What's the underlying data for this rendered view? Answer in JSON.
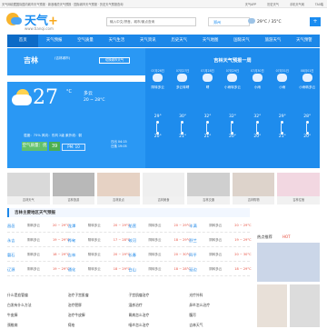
{
  "topbar": {
    "left_text": "天气网收藏国际国内城市天气预报 · 新浪雅虎天气预报 · 国际城市天气预报 · 历史天气预报查询",
    "right_items": [
      "天气APP",
      "历史天气",
      "手机天气网",
      "TA0端"
    ]
  },
  "logo": {
    "text": "天气",
    "plus": "+",
    "url": "www.tianqi.com"
  },
  "search": {
    "placeholder": "输入中文/拼音，城市/景点查询"
  },
  "location": {
    "value": "郑州"
  },
  "current_temp": {
    "text": "29°C / 35°C"
  },
  "nav": {
    "items": [
      "首页",
      "天气预报",
      "空气质量",
      "天气生活",
      "天气资讯",
      "历史天气",
      "天气地图",
      "国际天气",
      "旅游天气",
      "天气预警"
    ]
  },
  "main": {
    "city": "吉林",
    "city_link": "(吉林城市)",
    "switch_label": "切换城市天气",
    "date_line": "2019年07月26日  星期五  农历六月廿四",
    "temp": "27",
    "temp_unit": "°C",
    "cond": "多云",
    "range": "20 ~ 28°C",
    "winds": "湿度：75%   风向：东风 2级   紫外线：弱",
    "aqi_label": "空气质量：优",
    "aqi_value": "39",
    "pm": "PM: 10",
    "sun_rise": "日出 04:15",
    "sun_set": "日落 19:05"
  },
  "forecast": {
    "title": "吉林天气预报一周",
    "days": [
      {
        "date": "07月26日",
        "cond": "阴转多云",
        "high": "29°",
        "low": "20°"
      },
      {
        "date": "07月27日",
        "cond": "多云转晴",
        "high": "30°",
        "low": "21°"
      },
      {
        "date": "07月28日",
        "cond": "晴",
        "high": "32°",
        "low": "21°"
      },
      {
        "date": "07月29日",
        "cond": "小雨转多云",
        "high": "32°",
        "low": "20°"
      },
      {
        "date": "07月30日",
        "cond": "小雨",
        "high": "32°",
        "low": "20°"
      },
      {
        "date": "07月31日",
        "cond": "小雨",
        "high": "29°",
        "low": "21°"
      },
      {
        "date": "08月01日",
        "cond": "小雨转多云",
        "high": "28°",
        "low": "20°"
      }
    ]
  },
  "ads": [
    {
      "caption": "吉林天气"
    },
    {
      "caption": "吉林旅游"
    },
    {
      "caption": "吉林景点"
    },
    {
      "caption": "吉林美食"
    },
    {
      "caption": "吉林交通"
    },
    {
      "caption": "吉林购物"
    },
    {
      "caption": "吉林住宿"
    }
  ],
  "list": {
    "title": "吉林主要地区天气预报",
    "rows": [
      [
        {
          "name": "昌邑",
          "cond": "阴转多云",
          "temp": "20 ~ 29°C"
        },
        {
          "name": "龙潭",
          "cond": "阴转多云",
          "temp": "20 ~ 29°C"
        },
        {
          "name": "船营",
          "cond": "阴转多云",
          "temp": "20 ~ 29°C"
        },
        {
          "name": "丰满",
          "cond": "阴转多云",
          "temp": "20 ~ 29°C"
        }
      ],
      [
        {
          "name": "永吉",
          "cond": "阴转多云",
          "temp": "19 ~ 29°C"
        },
        {
          "name": "桦甸",
          "cond": "阴转多云",
          "temp": "17 ~ 28°C"
        },
        {
          "name": "蛟河",
          "cond": "阴转多云",
          "temp": "18 ~ 29°C"
        },
        {
          "name": "舒兰",
          "cond": "阴转多云",
          "temp": "19 ~ 29°C"
        }
      ],
      [
        {
          "name": "磐石",
          "cond": "阴转多云",
          "temp": "18 ~ 29°C"
        },
        {
          "name": "吉林",
          "cond": "阴转多云",
          "temp": "20 ~ 29°C"
        },
        {
          "name": "长春",
          "cond": "阴转多云",
          "temp": "20 ~ 30°C"
        },
        {
          "name": "四平",
          "cond": "阴转多云",
          "temp": "20 ~ 30°C"
        }
      ],
      [
        {
          "name": "辽源",
          "cond": "阴转多云",
          "temp": "19 ~ 29°C"
        },
        {
          "name": "通化",
          "cond": "阴转多云",
          "temp": "18 ~ 29°C"
        },
        {
          "name": "白山",
          "cond": "阴转多云",
          "temp": "18 ~ 28°C"
        },
        {
          "name": "延边",
          "cond": "阴转多云",
          "temp": "18 ~ 29°C"
        }
      ]
    ]
  },
  "links": [
    "什么是血管瘤",
    "治疗子宫肌瘤",
    "子宫肌瘤治疗",
    "光疗外科",
    "白发有什么方法",
    "治疗肥胖",
    "湿疹治疗",
    "鼻炎怎么治疗",
    "牛皮癣",
    "治疗牛皮癣",
    "胃病怎么治疗",
    "腹泻",
    "颈椎病",
    "痔疮",
    "咽炎怎么治疗",
    "吉林天气"
  ],
  "hot": {
    "title": "热点推荐",
    "badge": "HOT"
  },
  "colors": {
    "primary": "#1c87e8",
    "panel": "#1e8ced",
    "aqi_good": "#62c16b",
    "temp_red": "#e74c3c"
  }
}
